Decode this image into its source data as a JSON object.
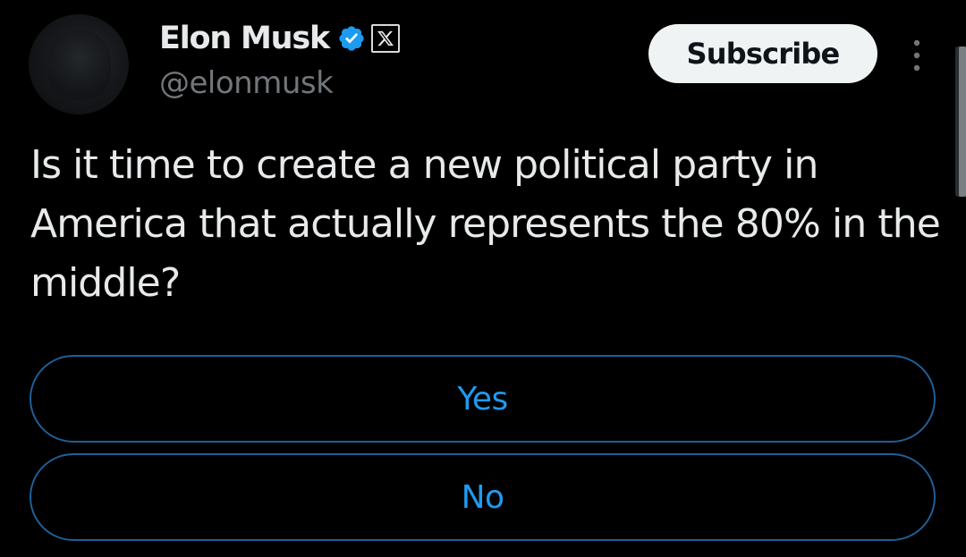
{
  "author": {
    "display_name": "Elon Musk",
    "handle": "@elonmusk",
    "avatar": "profile-avatar",
    "badges": [
      "verified-badge-icon",
      "x-affiliate-icon"
    ]
  },
  "actions": {
    "subscribe_label": "Subscribe",
    "more_icon": "more-vertical-icon"
  },
  "tweet": {
    "text": "Is it time to create a new political party in America that actually represents the 80% in the middle?"
  },
  "poll": {
    "options": [
      {
        "label": "Yes"
      },
      {
        "label": "No"
      }
    ]
  },
  "colors": {
    "background": "#000000",
    "primary_text": "#e7e9ea",
    "secondary_text": "#71767b",
    "accent": "#1d9bf0",
    "poll_border": "#1f5f96",
    "subscribe_bg": "#eff3f4"
  }
}
